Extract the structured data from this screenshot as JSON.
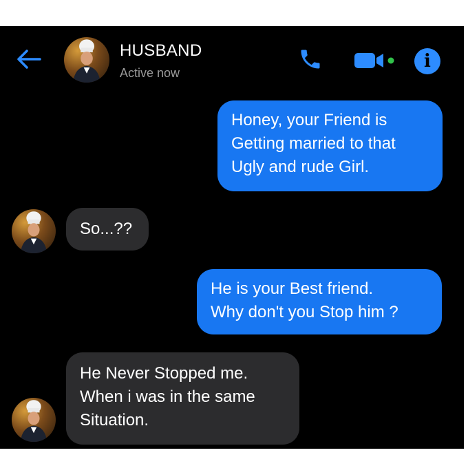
{
  "header": {
    "contact_name": "HUSBAND",
    "status": "Active now",
    "icons": [
      "back-arrow-icon",
      "phone-icon",
      "video-camera-icon",
      "info-icon"
    ],
    "accent_color": "#2d8cff",
    "info_glyph": "i"
  },
  "messages": [
    {
      "from": "me",
      "text": "Honey, your Friend is\nGetting married to that\nUgly and rude Girl."
    },
    {
      "from": "contact",
      "text": "So...??"
    },
    {
      "from": "me",
      "text": "He is your Best friend.\nWhy don't you Stop him ?"
    },
    {
      "from": "contact",
      "text": "He Never Stopped me.\nWhen i was in the same\nSituation."
    }
  ],
  "colors": {
    "sent_bubble": "#1877f2",
    "received_bubble": "#2c2c2e",
    "background": "#000000"
  }
}
